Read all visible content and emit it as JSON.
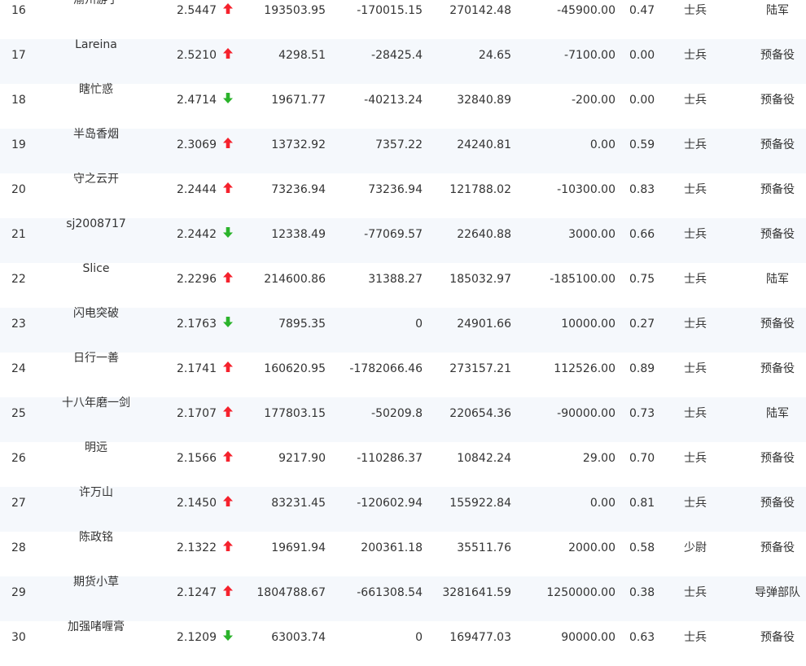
{
  "colors": {
    "up": "#f5222d",
    "down": "#2bb32b",
    "row_alt": "#f5f8fc",
    "text": "#333333"
  },
  "rows": [
    {
      "rank": "16",
      "name": "渝州游子",
      "score": "2.5447",
      "trend": "up",
      "v1": "193503.95",
      "v2": "-170015.15",
      "v3": "270142.48",
      "v4": "-45900.00",
      "ratio": "0.47",
      "rank_title": "士兵",
      "army": "陆军"
    },
    {
      "rank": "17",
      "name": "Lareina",
      "score": "2.5210",
      "trend": "up",
      "v1": "4298.51",
      "v2": "-28425.4",
      "v3": "24.65",
      "v4": "-7100.00",
      "ratio": "0.00",
      "rank_title": "士兵",
      "army": "预备役"
    },
    {
      "rank": "18",
      "name": "瞎忙惑",
      "score": "2.4714",
      "trend": "down",
      "v1": "19671.77",
      "v2": "-40213.24",
      "v3": "32840.89",
      "v4": "-200.00",
      "ratio": "0.00",
      "rank_title": "士兵",
      "army": "预备役"
    },
    {
      "rank": "19",
      "name": "半岛香烟",
      "score": "2.3069",
      "trend": "up",
      "v1": "13732.92",
      "v2": "7357.22",
      "v3": "24240.81",
      "v4": "0.00",
      "ratio": "0.59",
      "rank_title": "士兵",
      "army": "预备役"
    },
    {
      "rank": "20",
      "name": "守之云开",
      "score": "2.2444",
      "trend": "up",
      "v1": "73236.94",
      "v2": "73236.94",
      "v3": "121788.02",
      "v4": "-10300.00",
      "ratio": "0.83",
      "rank_title": "士兵",
      "army": "预备役"
    },
    {
      "rank": "21",
      "name": "sj2008717",
      "score": "2.2442",
      "trend": "down",
      "v1": "12338.49",
      "v2": "-77069.57",
      "v3": "22640.88",
      "v4": "3000.00",
      "ratio": "0.66",
      "rank_title": "士兵",
      "army": "预备役"
    },
    {
      "rank": "22",
      "name": "Slice",
      "score": "2.2296",
      "trend": "up",
      "v1": "214600.86",
      "v2": "31388.27",
      "v3": "185032.97",
      "v4": "-185100.00",
      "ratio": "0.75",
      "rank_title": "士兵",
      "army": "陆军"
    },
    {
      "rank": "23",
      "name": "闪电突破",
      "score": "2.1763",
      "trend": "down",
      "v1": "7895.35",
      "v2": "0",
      "v3": "24901.66",
      "v4": "10000.00",
      "ratio": "0.27",
      "rank_title": "士兵",
      "army": "预备役"
    },
    {
      "rank": "24",
      "name": "日行一善",
      "score": "2.1741",
      "trend": "up",
      "v1": "160620.95",
      "v2": "-1782066.46",
      "v3": "273157.21",
      "v4": "112526.00",
      "ratio": "0.89",
      "rank_title": "士兵",
      "army": "预备役"
    },
    {
      "rank": "25",
      "name": "十八年磨一剑",
      "score": "2.1707",
      "trend": "up",
      "v1": "177803.15",
      "v2": "-50209.8",
      "v3": "220654.36",
      "v4": "-90000.00",
      "ratio": "0.73",
      "rank_title": "士兵",
      "army": "陆军"
    },
    {
      "rank": "26",
      "name": "明远",
      "score": "2.1566",
      "trend": "up",
      "v1": "9217.90",
      "v2": "-110286.37",
      "v3": "10842.24",
      "v4": "29.00",
      "ratio": "0.70",
      "rank_title": "士兵",
      "army": "预备役"
    },
    {
      "rank": "27",
      "name": "许万山",
      "score": "2.1450",
      "trend": "up",
      "v1": "83231.45",
      "v2": "-120602.94",
      "v3": "155922.84",
      "v4": "0.00",
      "ratio": "0.81",
      "rank_title": "士兵",
      "army": "预备役"
    },
    {
      "rank": "28",
      "name": "陈政铭",
      "score": "2.1322",
      "trend": "up",
      "v1": "19691.94",
      "v2": "200361.18",
      "v3": "35511.76",
      "v4": "2000.00",
      "ratio": "0.58",
      "rank_title": "少尉",
      "army": "预备役"
    },
    {
      "rank": "29",
      "name": "期货小草",
      "score": "2.1247",
      "trend": "up",
      "v1": "1804788.67",
      "v2": "-661308.54",
      "v3": "3281641.59",
      "v4": "1250000.00",
      "ratio": "0.38",
      "rank_title": "士兵",
      "army": "导弹部队"
    },
    {
      "rank": "30",
      "name": "加强啫喱膏",
      "score": "2.1209",
      "trend": "down",
      "v1": "63003.74",
      "v2": "0",
      "v3": "169477.03",
      "v4": "90000.00",
      "ratio": "0.63",
      "rank_title": "士兵",
      "army": "预备役"
    }
  ]
}
